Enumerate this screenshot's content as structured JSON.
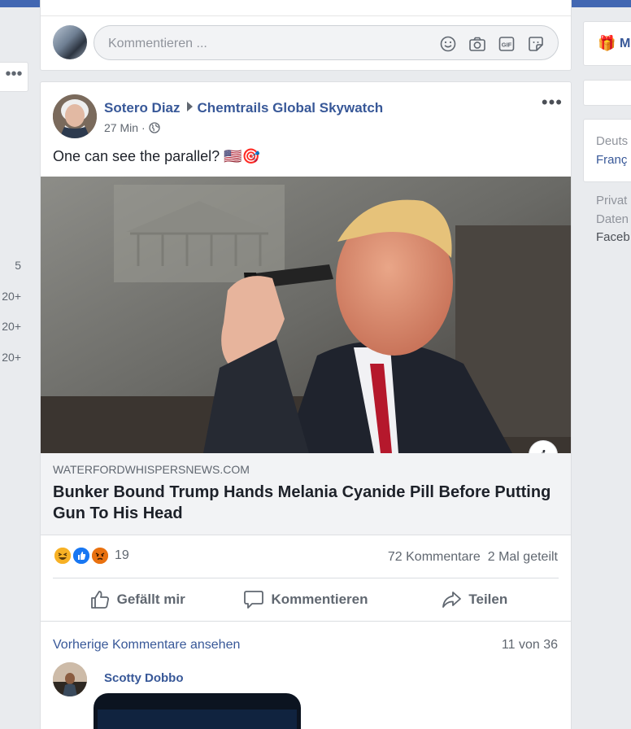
{
  "composer": {
    "placeholder": "Kommentieren ...",
    "icons": [
      "emoji-icon",
      "camera-icon",
      "gif-icon",
      "sticker-icon"
    ]
  },
  "left_counts": [
    "5",
    "20+",
    "20+",
    "20+"
  ],
  "right_column": {
    "gift_label": "M",
    "languages": [
      "Deuts",
      "Franç"
    ],
    "footer": [
      "Privat",
      "Daten",
      "Faceb"
    ]
  },
  "post": {
    "author": "Sotero Diaz",
    "group": "Chemtrails Global Skywatch",
    "time": "27 Min",
    "dot": "·",
    "text": "One can see the parallel? 🇺🇸🎯",
    "link": {
      "domain": "WATERFORDWHISPERSNEWS.COM",
      "title": "Bunker Bound Trump Hands Melania Cyanide Pill Before Putting Gun To His Head"
    },
    "reactions": {
      "count": "19",
      "types": [
        "haha",
        "like",
        "angry"
      ]
    },
    "comments_count": "72 Kommentare",
    "shares": "2 Mal geteilt",
    "actions": {
      "like": "Gefällt mir",
      "comment": "Kommentieren",
      "share": "Teilen"
    },
    "comments": {
      "previous_link": "Vorherige Kommentare ansehen",
      "count_of": "11 von 36",
      "first_author": "Scotty Dobbo"
    }
  },
  "colors": {
    "brand_blue": "#4267b2",
    "link_blue": "#385898",
    "text_secondary": "#606770",
    "haha_yellow": "#f7b125",
    "like_blue": "#1877f2",
    "angry_orange": "#e9710f"
  }
}
